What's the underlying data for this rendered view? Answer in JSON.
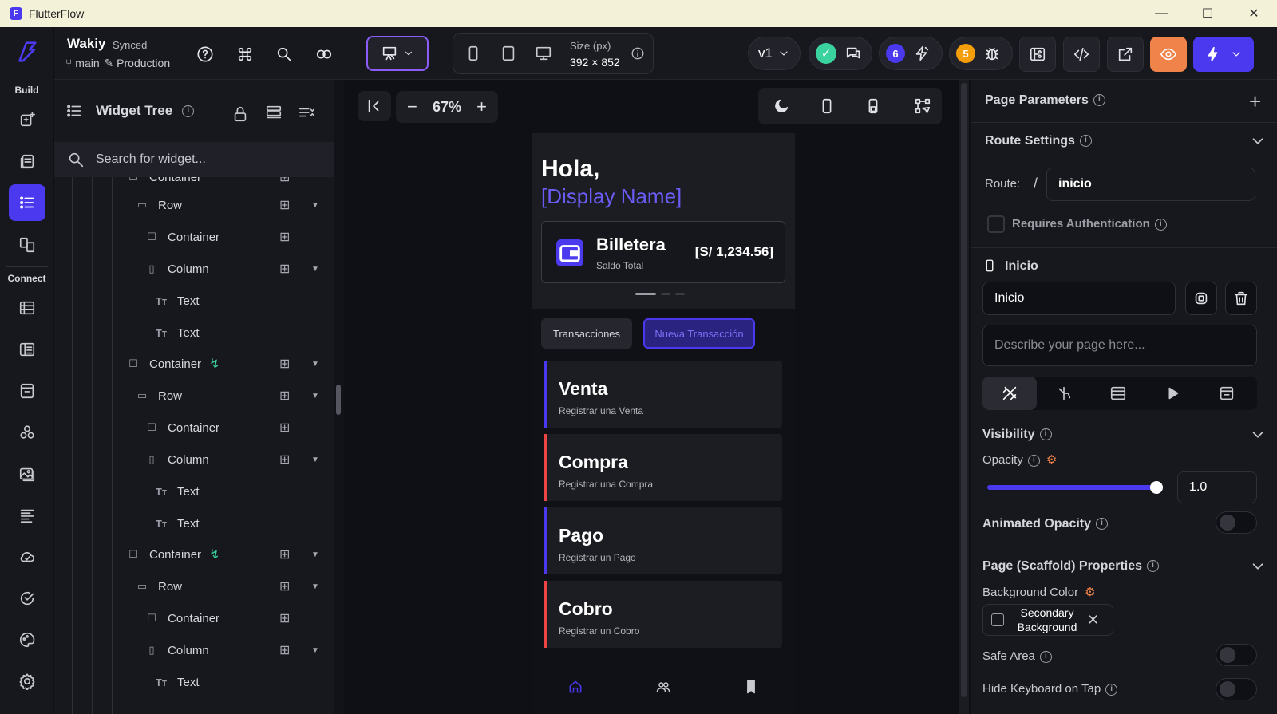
{
  "window": {
    "title": "FlutterFlow",
    "minimize": "—",
    "maximize": "☐",
    "close": "✕"
  },
  "rail": {
    "build_label": "Build",
    "connect_label": "Connect"
  },
  "project": {
    "name": "Wakiy",
    "status": "Synced",
    "branch": "main",
    "env": "Production"
  },
  "device": {
    "size_label": "Size (px)",
    "size_value": "392 × 852"
  },
  "version": {
    "label": "v1"
  },
  "badges": {
    "comments": "6",
    "bugs": "5"
  },
  "colors": {
    "accent": "#4b39ef",
    "green": "#3ad29f",
    "orange": "#f59e0b",
    "red": "#ef4444",
    "preview": "#f0834a"
  },
  "tree": {
    "title": "Widget Tree",
    "search_placeholder": "Search for widget...",
    "rows": [
      {
        "label": "Container",
        "icon": "container"
      },
      {
        "label": "Row",
        "icon": "row"
      },
      {
        "label": "Container",
        "icon": "container"
      },
      {
        "label": "Column",
        "icon": "column"
      },
      {
        "label": "Text",
        "icon": "text"
      },
      {
        "label": "Text",
        "icon": "text"
      },
      {
        "label": "Container",
        "icon": "container"
      },
      {
        "label": "Row",
        "icon": "row"
      },
      {
        "label": "Container",
        "icon": "container"
      },
      {
        "label": "Column",
        "icon": "column"
      },
      {
        "label": "Text",
        "icon": "text"
      },
      {
        "label": "Text",
        "icon": "text"
      },
      {
        "label": "Container",
        "icon": "container"
      },
      {
        "label": "Row",
        "icon": "row"
      },
      {
        "label": "Container",
        "icon": "container"
      },
      {
        "label": "Column",
        "icon": "column"
      },
      {
        "label": "Text",
        "icon": "text"
      }
    ]
  },
  "canvas": {
    "zoom": "67%"
  },
  "phone": {
    "greeting": "Hola,",
    "display_name": "[Display Name]",
    "wallet_name": "Billetera",
    "wallet_sub": "Saldo Total",
    "wallet_amount": "[S/ 1,234.56]",
    "tab_transactions": "Transacciones",
    "tab_new": "Nueva Transacción",
    "cards": [
      {
        "title": "Venta",
        "subtitle": "Registrar una Venta",
        "color": "#4b39ef"
      },
      {
        "title": "Compra",
        "subtitle": "Registrar una Compra",
        "color": "#ef4444"
      },
      {
        "title": "Pago",
        "subtitle": "Registrar un Pago",
        "color": "#4b39ef"
      },
      {
        "title": "Cobro",
        "subtitle": "Registrar un Cobro",
        "color": "#ef4444"
      }
    ]
  },
  "props": {
    "page_parameters": "Page Parameters",
    "route_settings": "Route Settings",
    "route_label": "Route:",
    "route_slash": "/",
    "route_value": "inicio",
    "requires_auth": "Requires Authentication",
    "page_section": "Inicio",
    "page_name": "Inicio",
    "describe_placeholder": "Describe your page here...",
    "visibility": "Visibility",
    "opacity_label": "Opacity",
    "opacity_value": "1.0",
    "opacity_fraction": 1.0,
    "animated_opacity": "Animated Opacity",
    "scaffold": "Page (Scaffold) Properties",
    "bg_color_label": "Background Color",
    "bg_color_value": "Secondary Background",
    "safe_area": "Safe Area",
    "hide_keyboard": "Hide Keyboard on Tap"
  }
}
